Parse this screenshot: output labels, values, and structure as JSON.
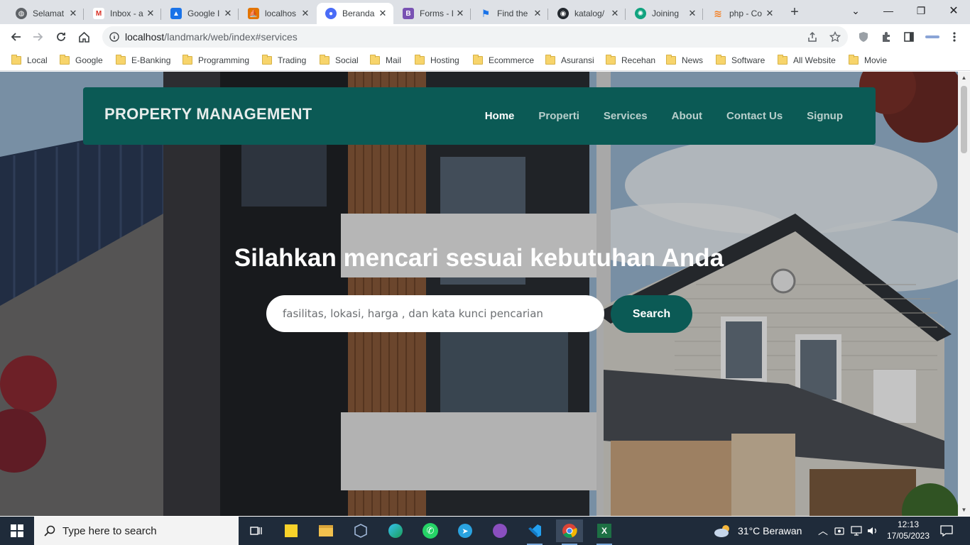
{
  "browser": {
    "tabs": [
      {
        "label": "Selamat",
        "icon": "globe-icon",
        "color": "#5f6368",
        "active": false
      },
      {
        "label": "Inbox - a",
        "icon": "gmail-icon",
        "color": "#d93025",
        "active": false
      },
      {
        "label": "Google I",
        "icon": "google-drive-icon",
        "color": "#1a73e8",
        "active": false
      },
      {
        "label": "localhos",
        "icon": "phpmyadmin-icon",
        "color": "#e37400",
        "active": false
      },
      {
        "label": "Beranda",
        "icon": "site-icon",
        "color": "#4a6cf7",
        "active": true
      },
      {
        "label": "Forms - I",
        "icon": "bootstrap-icon",
        "color": "#7952b3",
        "active": false
      },
      {
        "label": "Find the",
        "icon": "flag-icon",
        "color": "#1a73e8",
        "active": false
      },
      {
        "label": "katalog/",
        "icon": "github-icon",
        "color": "#24292f",
        "active": false
      },
      {
        "label": "Joining",
        "icon": "openai-icon",
        "color": "#10a37f",
        "active": false
      },
      {
        "label": "php - Co",
        "icon": "stackoverflow-icon",
        "color": "#f48024",
        "active": false
      }
    ],
    "new_tab": "+",
    "url_host": "localhost",
    "url_path": "/landmark/web/index#services",
    "bookmarks": [
      "Local",
      "Google",
      "E-Banking",
      "Programming",
      "Trading",
      "Social",
      "Mail",
      "Hosting",
      "Ecommerce",
      "Asuransi",
      "Recehan",
      "News",
      "Software",
      "All Website",
      "Movie"
    ]
  },
  "page": {
    "brand": "PROPERTY MANAGEMENT",
    "nav": [
      {
        "label": "Home",
        "active": true
      },
      {
        "label": "Properti",
        "active": false
      },
      {
        "label": "Services",
        "active": false
      },
      {
        "label": "About",
        "active": false
      },
      {
        "label": "Contact Us",
        "active": false
      },
      {
        "label": "Signup",
        "active": false
      }
    ],
    "hero_title": "Silahkan mencari sesuai kebutuhan Anda",
    "search_placeholder": "fasilitas, lokasi, harga , dan kata kunci pencarian",
    "search_button": "Search",
    "colors": {
      "primary": "#0b5a55",
      "nav_text": "#b9cfcc"
    }
  },
  "taskbar": {
    "search_placeholder": "Type here to search",
    "weather": "31°C  Berawan",
    "time": "12:13",
    "date": "17/05/2023",
    "apps": [
      "task-view-icon",
      "sticky-notes-icon",
      "file-explorer-icon",
      "virtualbox-icon",
      "edge-icon",
      "whatsapp-icon",
      "telegram-icon",
      "github-desktop-icon",
      "vscode-icon",
      "chrome-icon",
      "excel-icon"
    ]
  }
}
